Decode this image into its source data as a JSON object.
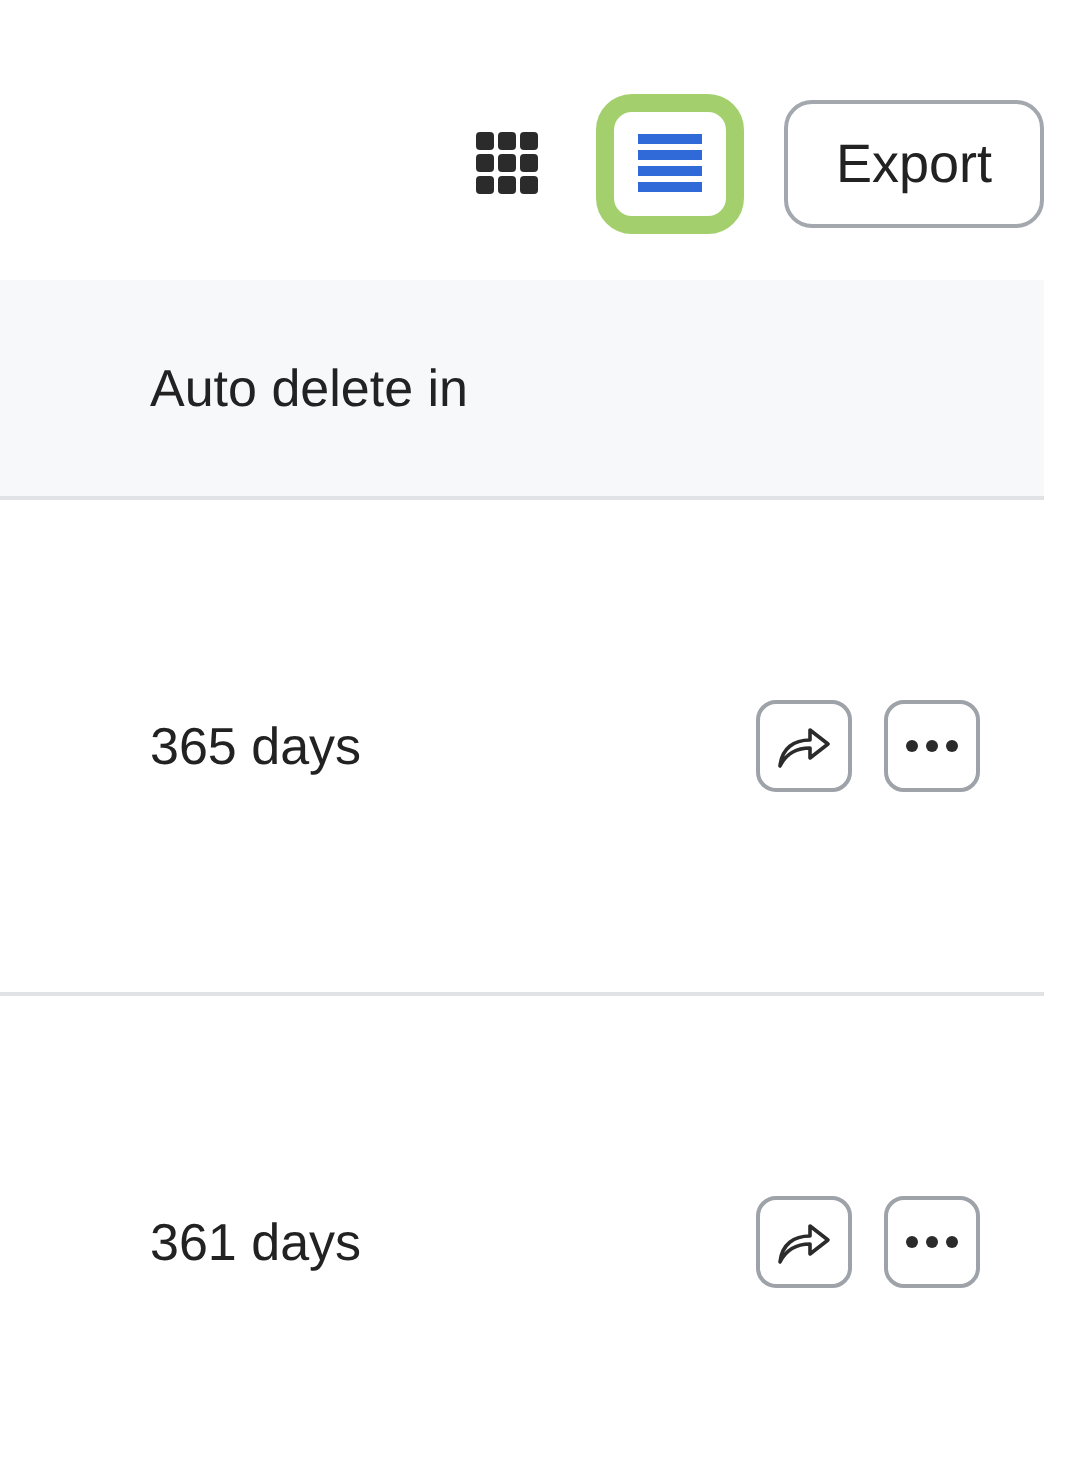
{
  "toolbar": {
    "view_modes": [
      {
        "kind": "grid",
        "selected": false
      },
      {
        "kind": "list",
        "selected": true
      }
    ],
    "export_button": "Export"
  },
  "table": {
    "columns": [
      "Auto delete in"
    ],
    "rows": [
      {
        "auto_delete_in": "365 days"
      },
      {
        "auto_delete_in": "361 days"
      }
    ]
  }
}
